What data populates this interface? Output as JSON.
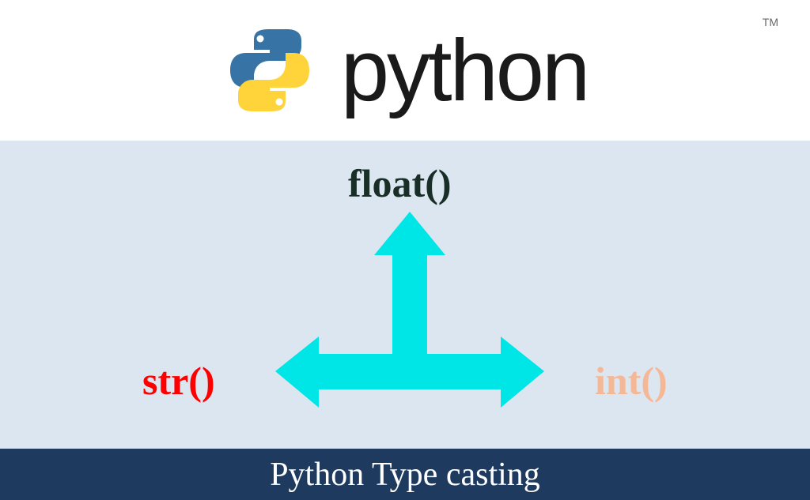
{
  "header": {
    "title": "python",
    "trademark": "TM"
  },
  "diagram": {
    "functions": {
      "top": "float()",
      "left": "str()",
      "right": "int()"
    },
    "colors": {
      "arrow": "#00e5e5",
      "float_label": "#1a2e28",
      "str_label": "#ff0000",
      "int_label": "#f5b896",
      "background": "#dce6f0",
      "footer_bg": "#1e3a5f"
    }
  },
  "footer": {
    "title": "Python Type casting"
  }
}
